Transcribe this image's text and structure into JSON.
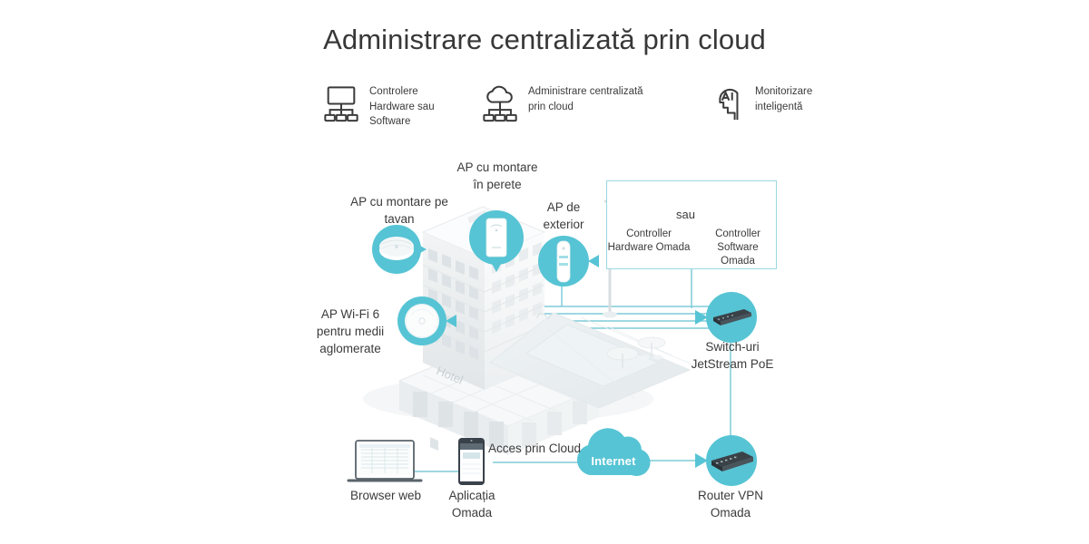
{
  "page": {
    "title": "Administrare centralizată prin cloud",
    "accent_teal": "#56c4d4",
    "accent_teal_light": "#9ad8e2",
    "line_teal": "#7fccd9",
    "text_color": "#3b3b3b",
    "background": "#ffffff"
  },
  "features": [
    {
      "icon": "monitor-network-icon",
      "label": "Controlere\nHardware sau\nSoftware"
    },
    {
      "icon": "cloud-network-icon",
      "label": "Administrare centralizată\nprin cloud"
    },
    {
      "icon": "ai-head-icon",
      "label": "Monitorizare\ninteligentă"
    }
  ],
  "diagram": {
    "labels": {
      "ceiling_ap": "AP cu montare pe\ntavan",
      "wall_ap": "AP cu montare\nîn perete",
      "outdoor_ap": "AP de\nexterior",
      "wifi6_ap": "AP Wi-Fi 6\npentru medii\naglomerate",
      "switches": "Switch-uri\nJetStream PoE",
      "browser": "Browser web",
      "mobile_app": "Aplicația\nOmada",
      "cloud_access": "Acces prin Cloud",
      "internet": "Internet",
      "vpn_router": "Router VPN\nOmada",
      "building_sign": "Hotel"
    },
    "controller_box": {
      "hardware_label": "Controller\nHardware Omada",
      "or_label": "sau",
      "software_label": "Controller\nSoftware\nOmada"
    }
  }
}
